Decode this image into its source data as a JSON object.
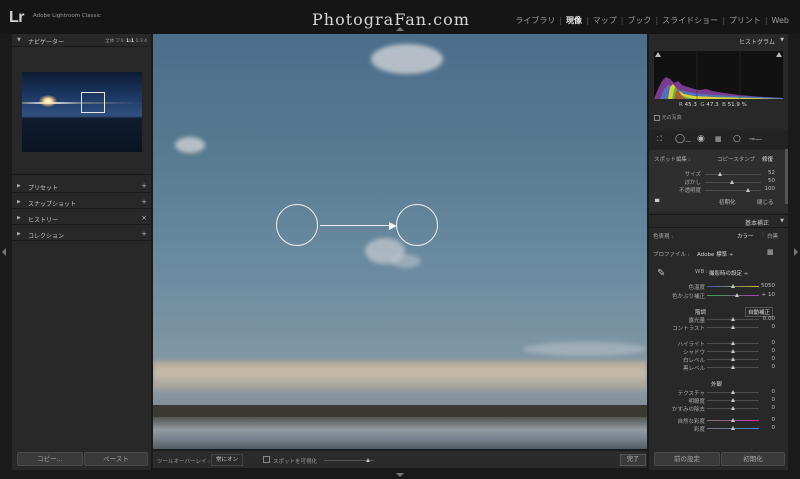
{
  "app": {
    "logo": "Lr",
    "name": "Adobe Lightroom Classic"
  },
  "watermark": "PhotograFan.com",
  "modules": [
    {
      "label": "ライブラリ",
      "active": false
    },
    {
      "label": "現像",
      "active": true
    },
    {
      "label": "マップ",
      "active": false
    },
    {
      "label": "ブック",
      "active": false
    },
    {
      "label": "スライドショー",
      "active": false
    },
    {
      "label": "プリント",
      "active": false
    },
    {
      "label": "Web",
      "active": false
    }
  ],
  "left": {
    "navigator": {
      "title": "ナビゲーター",
      "zoom_fit": "全体",
      "zoom_fill": "フル",
      "zoom_1": "1:1",
      "zoom_more": "1:3 4"
    },
    "panels": [
      {
        "title": "プリセット",
        "action": "+"
      },
      {
        "title": "スナップショット",
        "action": "+"
      },
      {
        "title": "ヒストリー",
        "action": "×"
      },
      {
        "title": "コレクション",
        "action": "+"
      }
    ],
    "copy_label": "コピー...",
    "paste_label": "ペースト"
  },
  "toolbar": {
    "overlay_label": "ツールオーバーレイ :",
    "overlay_value": "常にオン",
    "visualize_label": "スポットを可視化",
    "done_label": "完了"
  },
  "right": {
    "histogram": {
      "title": "ヒストグラム",
      "r_label": "R",
      "r": "45.3",
      "g_label": "G",
      "g": "47.3",
      "b_label": "B",
      "b": "51.9 %",
      "original_label": "元の写真"
    },
    "spot": {
      "label": "スポット編集 :",
      "clone": "コピースタンプ",
      "heal": "修復",
      "size_label": "サイズ",
      "size": "52",
      "feather_label": "ぼかし",
      "feather": "50",
      "opacity_label": "不透明度",
      "opacity": "100",
      "reset": "初期化",
      "close": "閉じる"
    },
    "basic": {
      "title": "基本補正",
      "treatment_label": "色表現 :",
      "color": "カラー",
      "bw": "白黒",
      "profile_label": "プロファイル :",
      "profile_value": "Adobe 標準 ÷",
      "wb_label": "WB :",
      "wb_value": "撮影時の設定 ÷",
      "temp_label": "色温度",
      "temp_value": "5050",
      "tint_label": "色かぶり補正",
      "tint_value": "+ 10",
      "tone_label": "階調",
      "auto_label": "自動補正",
      "exposure_label": "露光量",
      "exposure_value": "0.00",
      "contrast_label": "コントラスト",
      "contrast_value": "0",
      "highlights_label": "ハイライト",
      "highlights_value": "0",
      "shadows_label": "シャドウ",
      "shadows_value": "0",
      "whites_label": "白レベル",
      "whites_value": "0",
      "blacks_label": "黒レベル",
      "blacks_value": "0",
      "presence_label": "外観",
      "texture_label": "テクスチャ",
      "texture_value": "0",
      "clarity_label": "明瞭度",
      "clarity_value": "0",
      "dehaze_label": "かすみの除去",
      "dehaze_value": "0",
      "vibrance_label": "自然な彩度",
      "vibrance_value": "0",
      "saturation_label": "彩度",
      "saturation_value": "0"
    },
    "prev_label": "前の設定",
    "reset_label": "初期化"
  },
  "colors": {
    "panel": "#282828",
    "background": "#1a1a1a",
    "sky_top": "#4c6e8c",
    "accent_text": "#eaeaea"
  }
}
